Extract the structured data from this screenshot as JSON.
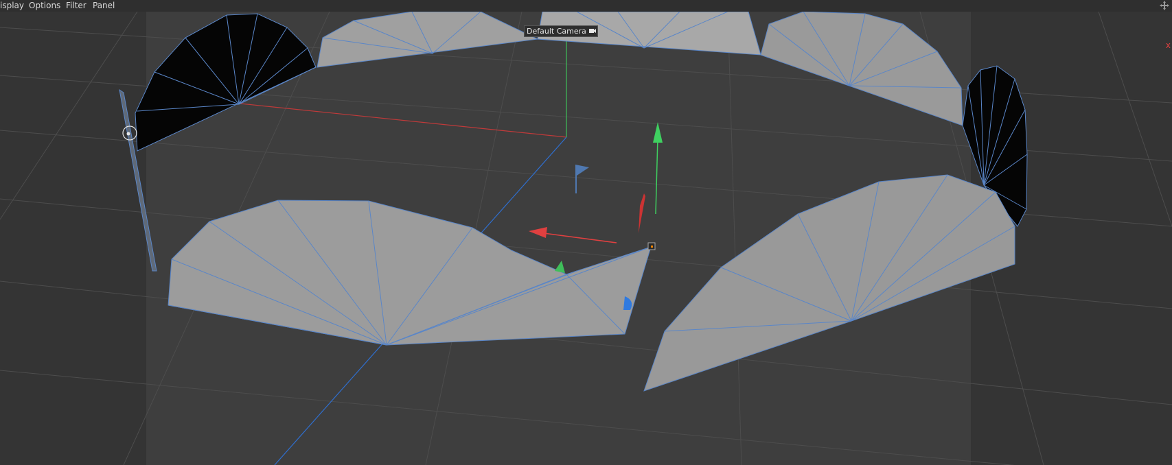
{
  "menu": {
    "items": [
      {
        "label": "isplay",
        "name": "menu-display"
      },
      {
        "label": "Options",
        "name": "menu-options"
      },
      {
        "label": "Filter",
        "name": "menu-filter"
      },
      {
        "label": "Panel",
        "name": "menu-panel"
      }
    ]
  },
  "viewport": {
    "camera_label": "Default Camera",
    "axis_label": "x"
  },
  "icons": {
    "navigate": "move-arrows-icon",
    "camera": "camera-icon"
  },
  "colors": {
    "background": "#3a3a3a",
    "safe_frame": "#444444",
    "mesh_fill": "#9c9c9c",
    "mesh_dark": "#050505",
    "wire": "#5a86c8",
    "x_axis": "#e04040",
    "y_axis": "#4ad06a",
    "z_axis": "#3a7ad8"
  }
}
